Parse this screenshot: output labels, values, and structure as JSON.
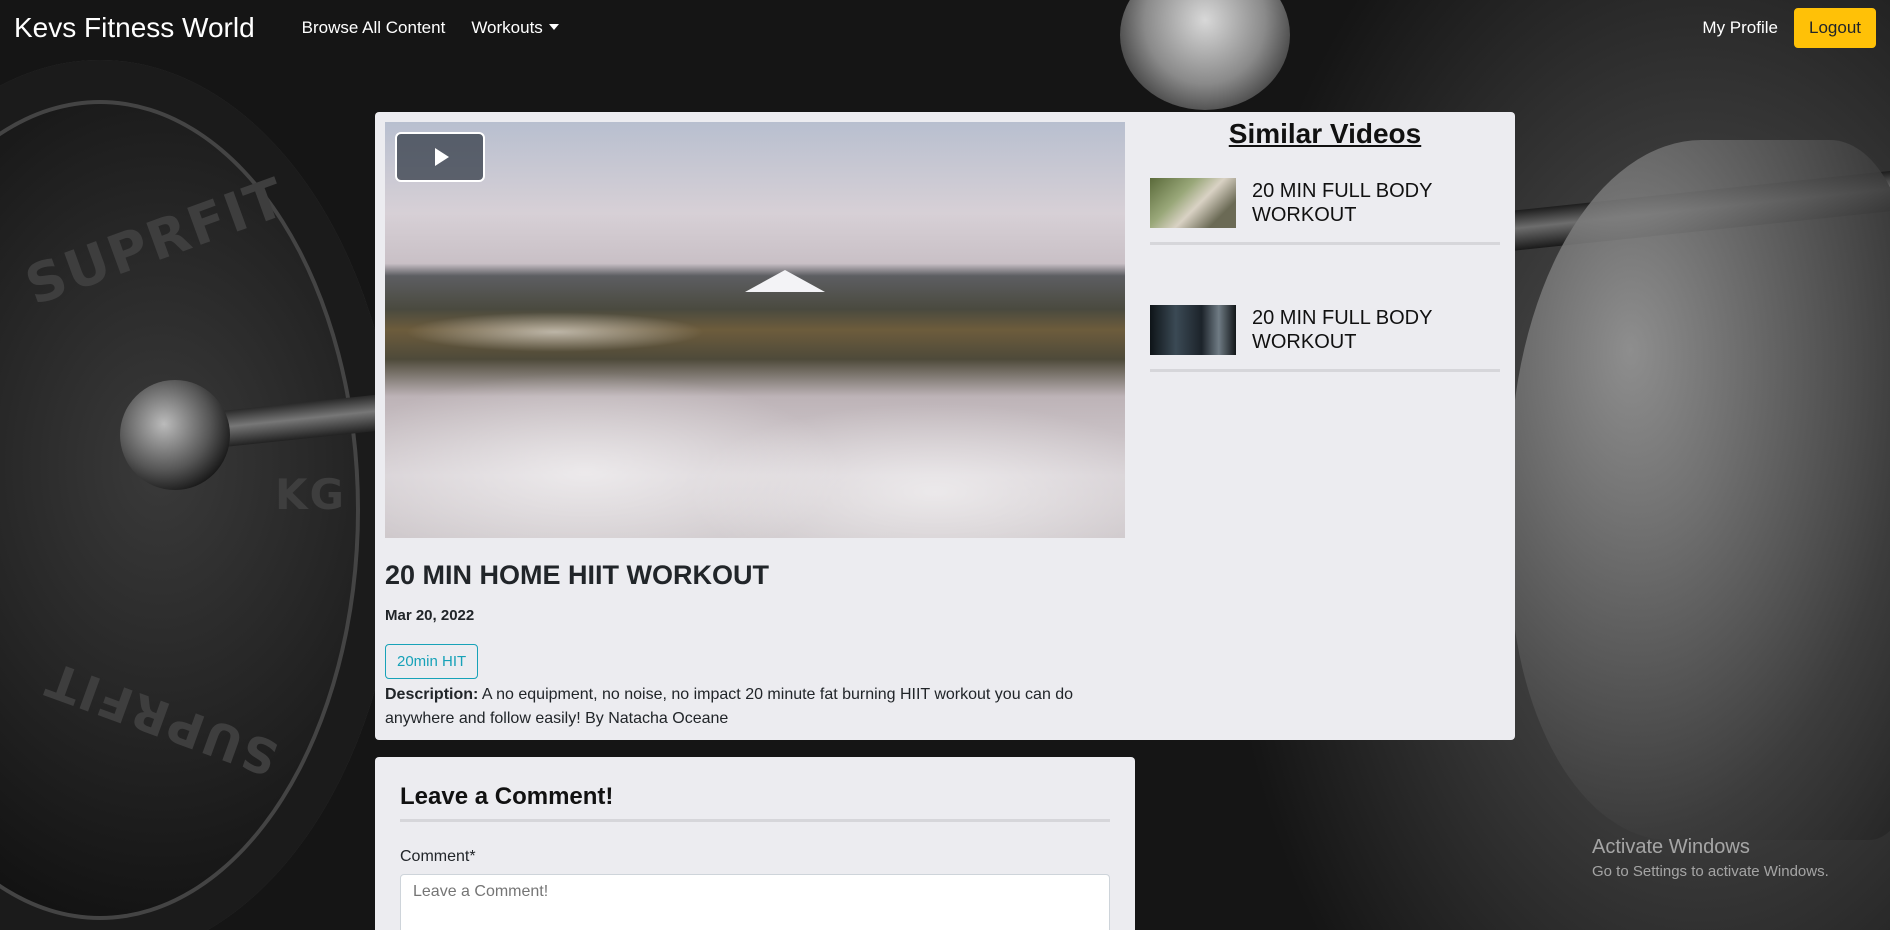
{
  "navbar": {
    "brand": "Kevs Fitness World",
    "browse_label": "Browse All Content",
    "workouts_label": "Workouts",
    "profile_label": "My Profile",
    "logout_label": "Logout"
  },
  "video": {
    "title": "20 MIN HOME HIIT WORKOUT",
    "date": "Mar 20, 2022",
    "tag": "20min HIT",
    "description_label": "Description:",
    "description_text": "A no equipment, no noise, no impact 20 minute fat burning HIIT workout you can do anywhere and follow easily! By Natacha Oceane"
  },
  "similar": {
    "heading": "Similar Videos",
    "items": [
      {
        "label": "20 MIN FULL BODY WORKOUT"
      },
      {
        "label": "20 MIN FULL BODY WORKOUT"
      }
    ]
  },
  "comment": {
    "heading": "Leave a Comment!",
    "field_label": "Comment*",
    "placeholder": "Leave a Comment!"
  },
  "background": {
    "plate_text_1": "SUPRFIT",
    "plate_text_2": "KG",
    "plate_text_3": "SUPRFIT"
  },
  "watermark": {
    "title": "Activate Windows",
    "subtitle": "Go to Settings to activate Windows."
  },
  "colors": {
    "logout_bg": "#ffc107",
    "tag_color": "#17a2b8",
    "card_bg": "#ececf0"
  }
}
